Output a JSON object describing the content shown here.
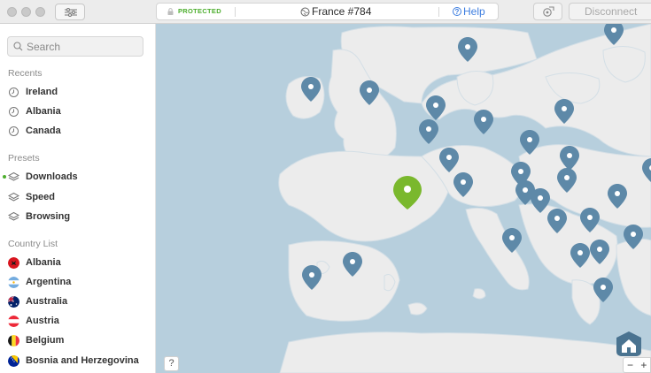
{
  "titlebar": {
    "status": "PROTECTED",
    "server": "France #784",
    "help": "Help",
    "disconnect": "Disconnect"
  },
  "sidebar": {
    "search_placeholder": "Search",
    "recents_header": "Recents",
    "recents": [
      "Ireland",
      "Albania",
      "Canada"
    ],
    "presets_header": "Presets",
    "presets": [
      "Downloads",
      "Speed",
      "Browsing"
    ],
    "country_header": "Country List",
    "countries": [
      "Albania",
      "Argentina",
      "Australia",
      "Austria",
      "Belgium",
      "Bosnia and Herzegovina"
    ]
  },
  "map": {
    "help_button": "?",
    "zoom_out": "−",
    "zoom_in": "+",
    "active_server_color": "#7ab82d",
    "server_pin_color": "#5e89a8",
    "water_color": "#b7cfdd",
    "land_color": "#ececec"
  },
  "colors": {
    "accent_green": "#4dae2e",
    "help_blue": "#3f7fe0"
  }
}
